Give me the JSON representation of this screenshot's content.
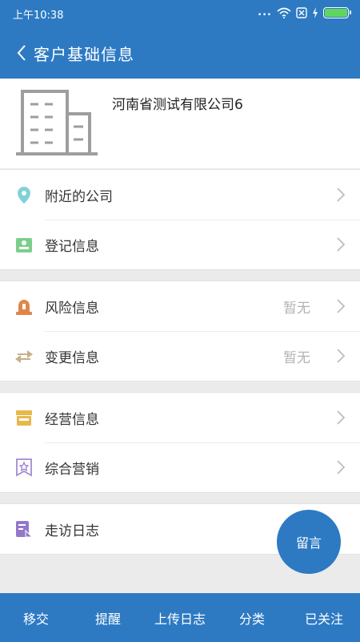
{
  "status_bar": {
    "time": "上午10:38",
    "dots": "...",
    "battery_level": 1.0
  },
  "header": {
    "title": "客户基础信息",
    "back_icon": "chevron-left-icon"
  },
  "company": {
    "name": "河南省测试有限公司6",
    "logo_icon": "building-icon"
  },
  "groups": [
    {
      "items": [
        {
          "label": "附近的公司",
          "icon": "location-pin-icon",
          "color": "#7fd1d8"
        },
        {
          "label": "登记信息",
          "icon": "id-card-icon",
          "color": "#7ccf8b"
        }
      ]
    },
    {
      "items": [
        {
          "label": "风险信息",
          "status": "暂无",
          "icon": "alarm-light-icon",
          "color": "#e0864a"
        },
        {
          "label": "变更信息",
          "status": "暂无",
          "icon": "swap-arrows-icon",
          "color": "#c6b089"
        }
      ]
    },
    {
      "items": [
        {
          "label": "经营信息",
          "icon": "store-icon",
          "color": "#e8b84b"
        },
        {
          "label": "综合营销",
          "icon": "star-ribbon-icon",
          "color": "#a38ad0"
        }
      ]
    },
    {
      "items": [
        {
          "label": "走访日志",
          "icon": "visit-log-icon",
          "color": "#9377c9"
        }
      ]
    }
  ],
  "fab": {
    "label": "留言"
  },
  "bottom_bar": {
    "tabs": [
      "移交",
      "提醒",
      "上传日志",
      "分类",
      "已关注"
    ]
  },
  "colors": {
    "primary": "#2d7ac3",
    "background": "#ebebeb",
    "status_text": "#b3b3b3"
  }
}
